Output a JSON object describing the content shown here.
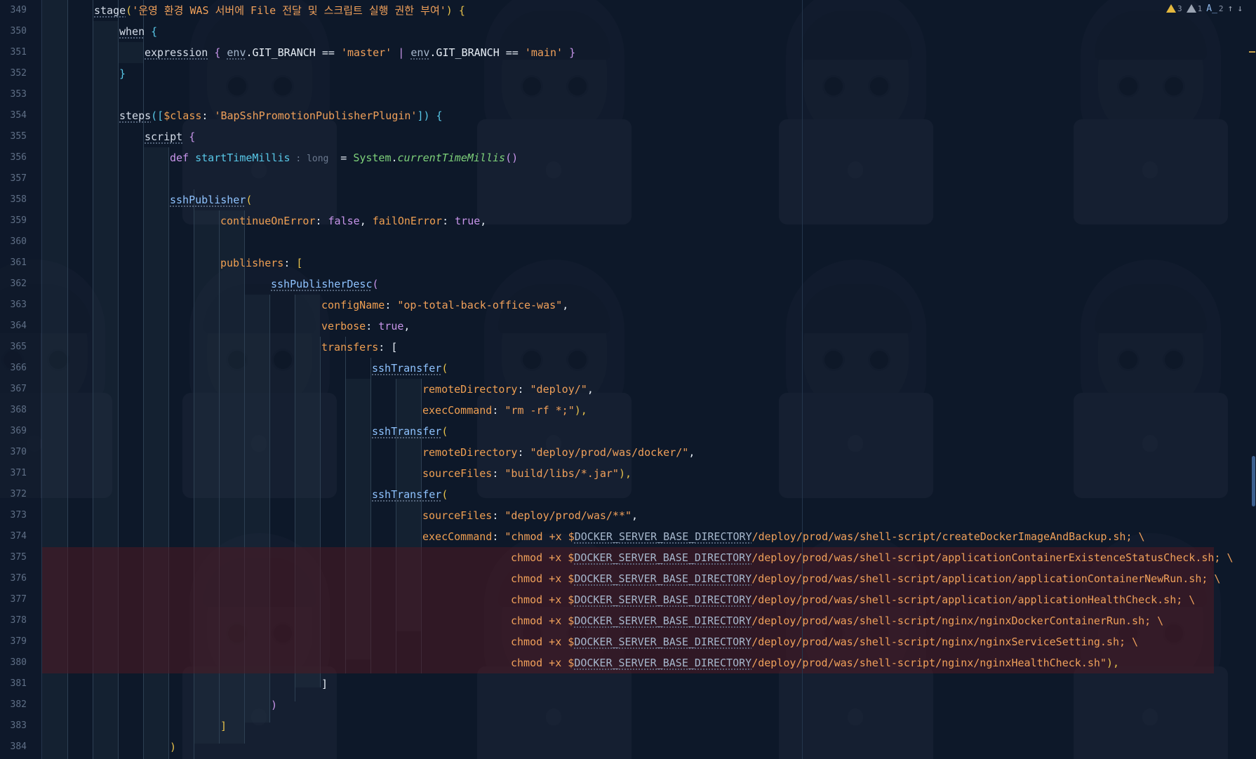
{
  "editor": {
    "inspections": {
      "warnings": "3",
      "weak_warnings": "1",
      "typos": "2",
      "prev_label": "↑",
      "next_label": "↓"
    },
    "line_numbers": [
      "349",
      "350",
      "351",
      "352",
      "353",
      "354",
      "355",
      "356",
      "357",
      "358",
      "359",
      "360",
      "361",
      "362",
      "363",
      "364",
      "365",
      "366",
      "367",
      "368",
      "369",
      "370",
      "371",
      "372",
      "373",
      "374",
      "375",
      "376",
      "377",
      "378",
      "379",
      "380",
      "381",
      "382",
      "383",
      "384"
    ],
    "lines": {
      "l349": {
        "fn": "stage",
        "open": "(",
        "str": "'운영 환경 WAS 서버에 File 전달 및 스크립트 실행 권한 부여'",
        "close": ") {"
      },
      "l350": {
        "fn": "when",
        "close": " {"
      },
      "l351": {
        "fn": "expression",
        "open": " { ",
        "env1": "env",
        "p1": ".GIT_BRANCH ",
        "op1": "==",
        "s1": " 'master'",
        "or": " | ",
        "env2": "env",
        "p2": ".GIT_BRANCH ",
        "op2": "==",
        "s2": " 'main'",
        "close": " }"
      },
      "l352": {
        "close": "}"
      },
      "l354": {
        "fn": "steps",
        "open": "([",
        "cls": "$class",
        "colon": ": ",
        "str": "'BapSshPromotionPublisherPlugin'",
        "close": "]) {"
      },
      "l355": {
        "fn": "script",
        "close": " {"
      },
      "l356": {
        "kw": "def ",
        "name": "startTimeMillis",
        "hint": " : long ",
        "eq": " = ",
        "cls": "System",
        "dot": ".",
        "call": "currentTimeMillis",
        "paren": "()"
      },
      "l358": {
        "fn": "sshPublisher",
        "open": "("
      },
      "l359": {
        "k1": "continueOnError",
        "c1": ": ",
        "v1": "false",
        "sep": ", ",
        "k2": "failOnError",
        "c2": ": ",
        "v2": "true",
        "end": ","
      },
      "l361": {
        "key": "publishers",
        "colon": ": ",
        "open": "["
      },
      "l362": {
        "fn": "sshPublisherDesc",
        "open": "("
      },
      "l363": {
        "key": "configName",
        "colon": ": ",
        "str": "\"op-total-back-office-was\"",
        "end": ","
      },
      "l364": {
        "key": "verbose",
        "colon": ": ",
        "val": "true",
        "end": ","
      },
      "l365": {
        "key": "transfers",
        "colon": ": ",
        "open": "["
      },
      "l366": {
        "fn": "sshTransfer",
        "open": "("
      },
      "l367": {
        "key": "remoteDirectory",
        "colon": ": ",
        "str": "\"deploy/\"",
        "end": ","
      },
      "l368": {
        "key": "execCommand",
        "colon": ": ",
        "str": "\"rm -rf *;\"",
        "end": "),"
      },
      "l369": {
        "fn": "sshTransfer",
        "open": "("
      },
      "l370": {
        "key": "remoteDirectory",
        "colon": ": ",
        "str": "\"deploy/prod/was/docker/\"",
        "end": ","
      },
      "l371": {
        "key": "sourceFiles",
        "colon": ": ",
        "str": "\"build/libs/*.jar\"",
        "end": "),"
      },
      "l372": {
        "fn": "sshTransfer",
        "open": "("
      },
      "l373": {
        "key": "sourceFiles",
        "colon": ": ",
        "str": "\"deploy/prod/was/**\"",
        "end": ","
      },
      "l374": {
        "key": "execCommand",
        "colon": ": ",
        "pre": "\"chmod +x $",
        "var": "DOCKER_SERVER_BASE_DIRECTORY",
        "post": "/deploy/prod/was/shell-script/createDockerImageAndBackup.sh; \\"
      },
      "l375": {
        "pre": "chmod +x $",
        "var": "DOCKER_SERVER_BASE_DIRECTORY",
        "post": "/deploy/prod/was/shell-script/applicationContainerExistenceStatusCheck.sh; \\"
      },
      "l376": {
        "pre": "chmod +x $",
        "var": "DOCKER_SERVER_BASE_DIRECTORY",
        "post": "/deploy/prod/was/shell-script/application/applicationContainerNewRun.sh; \\"
      },
      "l377": {
        "pre": "chmod +x $",
        "var": "DOCKER_SERVER_BASE_DIRECTORY",
        "post": "/deploy/prod/was/shell-script/application/applicationHealthCheck.sh; \\"
      },
      "l378": {
        "pre": "chmod +x $",
        "var": "DOCKER_SERVER_BASE_DIRECTORY",
        "post": "/deploy/prod/was/shell-script/nginx/nginxDockerContainerRun.sh; \\"
      },
      "l379": {
        "pre": "chmod +x $",
        "var": "DOCKER_SERVER_BASE_DIRECTORY",
        "post": "/deploy/prod/was/shell-script/nginx/nginxServiceSetting.sh; \\"
      },
      "l380": {
        "pre": "chmod +x $",
        "var": "DOCKER_SERVER_BASE_DIRECTORY",
        "post": "/deploy/prod/was/shell-script/nginx/nginxHealthCheck.sh\"",
        "end": "),"
      },
      "l381": {
        "close": "]"
      },
      "l382": {
        "close": ")"
      },
      "l383": {
        "close": "]"
      },
      "l384": {
        "close": ")"
      }
    }
  },
  "colors": {
    "background": "#0f1b2d",
    "keyword": "#c895ea",
    "string": "#f0a05a",
    "function": "#8fc3ff",
    "static_call": "#7ed27a",
    "warning": "#e4b83e"
  },
  "icons": {
    "warning": "warning-triangle-icon",
    "weak_warning": "weak-warning-triangle-icon",
    "typo": "typo-icon",
    "prev": "arrow-up-icon",
    "next": "arrow-down-icon"
  }
}
